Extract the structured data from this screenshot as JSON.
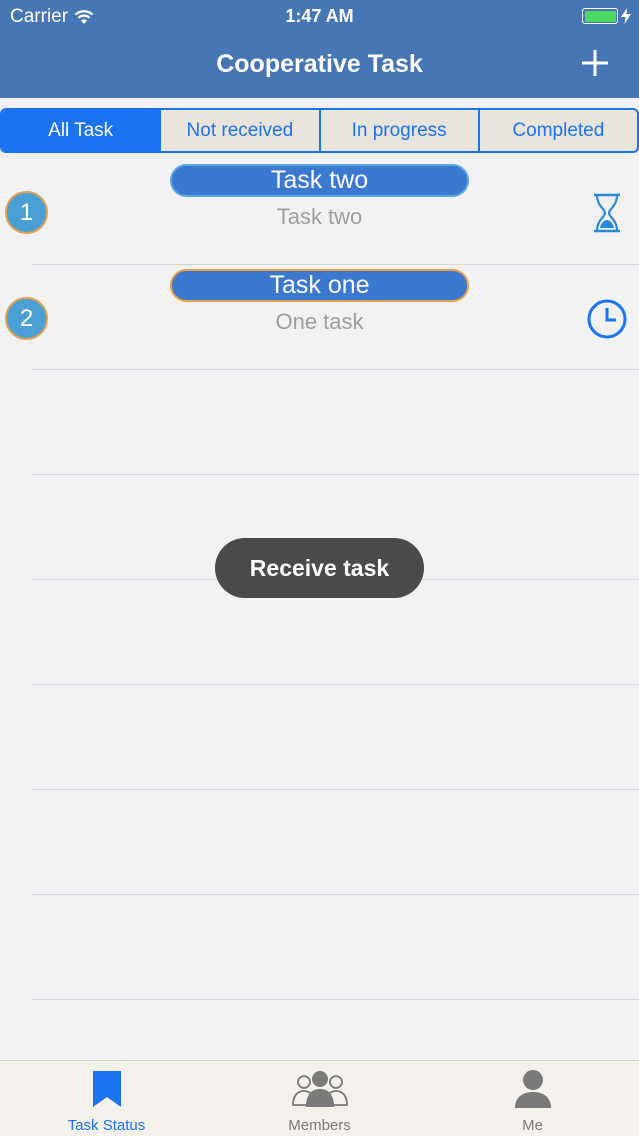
{
  "status_bar": {
    "carrier": "Carrier",
    "time": "1:47 AM"
  },
  "nav": {
    "title": "Cooperative Task",
    "add_icon": "plus-icon"
  },
  "segments": [
    {
      "label": "All Task",
      "active": true
    },
    {
      "label": "Not received",
      "active": false
    },
    {
      "label": "In progress",
      "active": false
    },
    {
      "label": "Completed",
      "active": false
    }
  ],
  "tasks": [
    {
      "number": "1",
      "title": "Task two",
      "subtitle": "Task two",
      "status_icon": "hourglass-icon"
    },
    {
      "number": "2",
      "title": "Task one",
      "subtitle": "One task",
      "status_icon": "clock-icon"
    }
  ],
  "toast": {
    "text": "Receive task"
  },
  "tabbar": {
    "items": [
      {
        "label": "Task Status",
        "icon": "bookmark-icon",
        "active": true
      },
      {
        "label": "Members",
        "icon": "group-icon",
        "active": false
      },
      {
        "label": "Me",
        "icon": "person-icon",
        "active": false
      }
    ]
  },
  "colors": {
    "nav_bg": "#4676b4",
    "accent": "#1a73f0",
    "badge": "#4aa0d4",
    "pill": "#3b78cf"
  }
}
